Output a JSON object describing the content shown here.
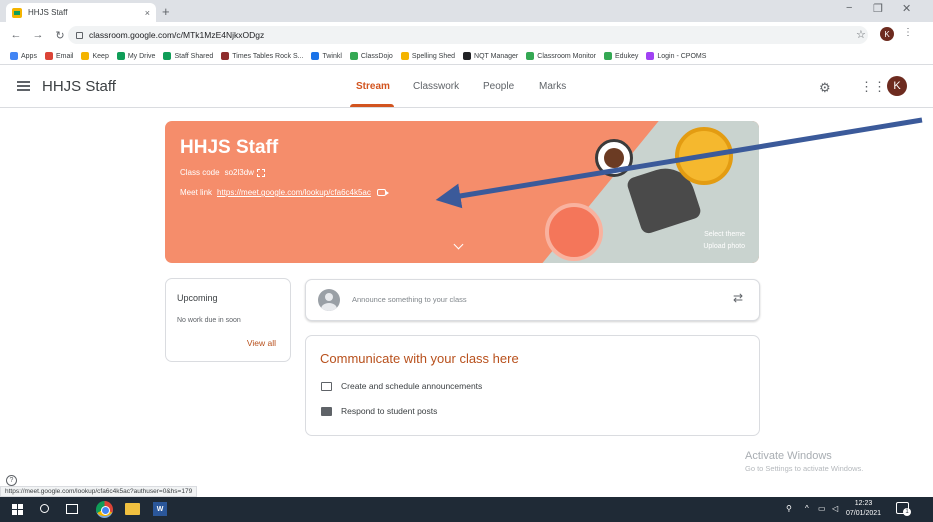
{
  "browser": {
    "tab_title": "HHJS Staff",
    "tab_close": "×",
    "new_tab": "+",
    "window_controls": [
      "−",
      "❐",
      "✕"
    ],
    "url": "classroom.google.com/c/MTk1MzE4NjkxODgz",
    "profile_initial": "K",
    "bookmarks": [
      {
        "label": "Apps",
        "color": "#4285f4"
      },
      {
        "label": "Email",
        "color": "#db4437"
      },
      {
        "label": "Keep",
        "color": "#f4b400"
      },
      {
        "label": "My Drive",
        "color": "#0f9d58"
      },
      {
        "label": "Staff Shared",
        "color": "#0f9d58"
      },
      {
        "label": "Times Tables Rock S...",
        "color": "#8e2c2c"
      },
      {
        "label": "Twinkl",
        "color": "#1a73e8"
      },
      {
        "label": "ClassDojo",
        "color": "#34a853"
      },
      {
        "label": "Spelling Shed",
        "color": "#f4b400"
      },
      {
        "label": "NQT Manager",
        "color": "#202124"
      },
      {
        "label": "Classroom Monitor",
        "color": "#34a853"
      },
      {
        "label": "Edukey",
        "color": "#34a853"
      },
      {
        "label": "Login - CPOMS",
        "color": "#a142f4"
      }
    ]
  },
  "header": {
    "class_title": "HHJS Staff",
    "tabs": [
      {
        "label": "Stream",
        "active": true
      },
      {
        "label": "Classwork",
        "active": false
      },
      {
        "label": "People",
        "active": false
      },
      {
        "label": "Marks",
        "active": false
      }
    ],
    "avatar_initial": "K"
  },
  "banner": {
    "title": "HHJS Staff",
    "class_code_label": "Class code",
    "class_code": "so2l3dw",
    "meet_link_label": "Meet link",
    "meet_link": "https://meet.google.com/lookup/cfa6c4k5ac",
    "select_theme": "Select theme",
    "upload_photo": "Upload photo",
    "color": "#f58d6b"
  },
  "upcoming": {
    "title": "Upcoming",
    "empty_text": "No work due in soon",
    "view_all": "View all"
  },
  "announce": {
    "placeholder": "Announce something to your class"
  },
  "communicate": {
    "title": "Communicate with your class here",
    "items": [
      {
        "label": "Create and schedule announcements"
      },
      {
        "label": "Respond to student posts"
      }
    ]
  },
  "watermark": {
    "title": "Activate Windows",
    "subtitle": "Go to Settings to activate Windows."
  },
  "status_url": "https://meet.google.com/lookup/cfa6c4k5ac?authuser=0&hs=179",
  "taskbar": {
    "time": "12:23",
    "date": "07/01/2021",
    "notification_count": "1"
  }
}
